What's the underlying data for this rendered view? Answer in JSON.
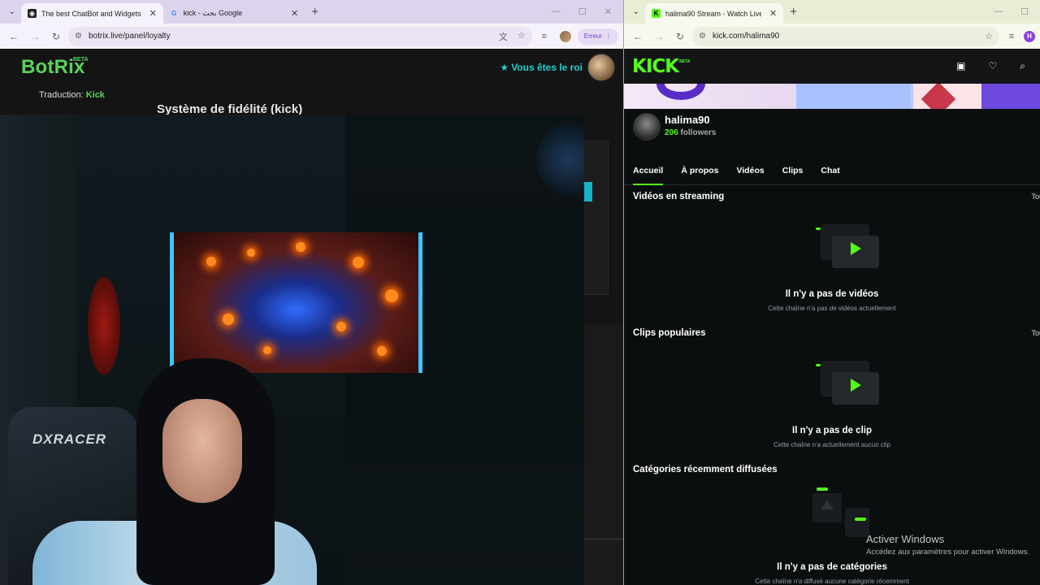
{
  "left_window": {
    "tabs": [
      {
        "title": "The best ChatBot and Widgets",
        "active": true
      },
      {
        "title": "kick - بحث Google",
        "active": false
      }
    ],
    "url": "botrix.live/panel/loyalty",
    "error_button": "Erreur",
    "page": {
      "logo": "BotRix",
      "beta": "BETA",
      "king_text": "Vous êtes le roi",
      "translation_label": "Traduction:",
      "translation_value": "Kick",
      "section_title": "Système de fidélité (kick)"
    },
    "webcam": {
      "chair_brand": "DXRACER"
    }
  },
  "right_window": {
    "tabs": [
      {
        "title": "halima90 Stream - Watch Live o",
        "active": true
      }
    ],
    "url": "kick.com/halima90",
    "page": {
      "logo": "KICK",
      "beta": "BETA",
      "channel_name": "halima90",
      "followers_count": "206",
      "followers_label": "followers",
      "tabs": [
        "Accueil",
        "À propos",
        "Vidéos",
        "Clips",
        "Chat"
      ],
      "sections": [
        {
          "title": "Vidéos en streaming",
          "link": "Tou",
          "empty_title": "Il n'y a pas de vidéos",
          "empty_sub": "Cette chaîne n'a pas de vidéos actuellement"
        },
        {
          "title": "Clips populaires",
          "link": "Tou",
          "empty_title": "Il n'y a pas de clip",
          "empty_sub": "Cette chaîne n'a actuellement aucun clip"
        },
        {
          "title": "Catégories récemment diffusées",
          "empty_title": "Il n'y a pas de catégories",
          "empty_sub": "Cette chaîne n'a diffusé aucune catégorie récemment"
        }
      ]
    },
    "watermark": {
      "title": "Activer Windows",
      "sub": "Accédez aux paramètres pour activer Windows."
    },
    "avatar_letter": "H"
  },
  "colors": {
    "botrix_green": "#5ad45a",
    "kick_green": "#53fc18",
    "cyan": "#1fd1d1"
  }
}
